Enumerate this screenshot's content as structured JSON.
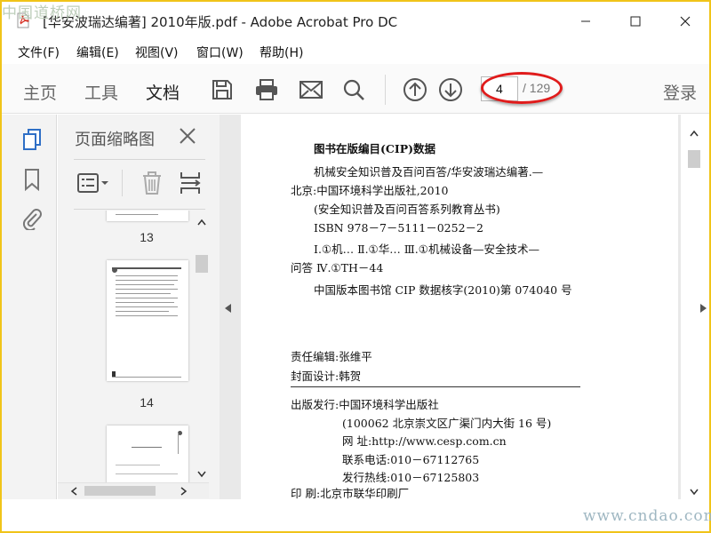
{
  "window": {
    "title": "[华安波瑞达编著] 2010年版.pdf - Adobe Acrobat Pro DC",
    "watermark_top": "中国道桥网",
    "watermark_bottom": "www.cndao.com"
  },
  "menu": [
    "文件(F)",
    "编辑(E)",
    "视图(V)",
    "窗口(W)",
    "帮助(H)"
  ],
  "toolbar": {
    "tabs": [
      "主页",
      "工具",
      "文档"
    ],
    "active_tab": "文档",
    "page_current": "4",
    "page_total": "/ 129",
    "signin": "登录",
    "annotation_color": "#e01b1b"
  },
  "thumbnails_panel": {
    "title": "页面缩略图",
    "pages": [
      "13",
      "14"
    ]
  },
  "document_page": {
    "lines": [
      "图书在版编目(CIP)数据",
      "机械安全知识普及百问百答/华安波瑞达编著.—",
      "北京:中国环境科学出版社,2010",
      "(安全知识普及百问百答系列教育丛书)",
      "ISBN 978－7－5111－0252－2",
      "Ⅰ.①机…  Ⅱ.①华…  Ⅲ.①机械设备—安全技术—",
      "问答  Ⅳ.①TH－44",
      "中国版本图书馆 CIP 数据核字(2010)第 074040 号",
      "责任编辑:张维平",
      "封面设计:韩贺",
      "出版发行:中国环境科学出版社",
      "(100062 北京崇文区广渠门内大街 16 号)",
      "网      址:http://www.cesp.com.cn",
      "联系电话:010－67112765",
      "发行热线:010－67125803",
      "印      刷:北京市联华印刷厂"
    ]
  },
  "colors": {
    "accent": "#2f6fc6",
    "highlight_border": "#f0c419"
  }
}
